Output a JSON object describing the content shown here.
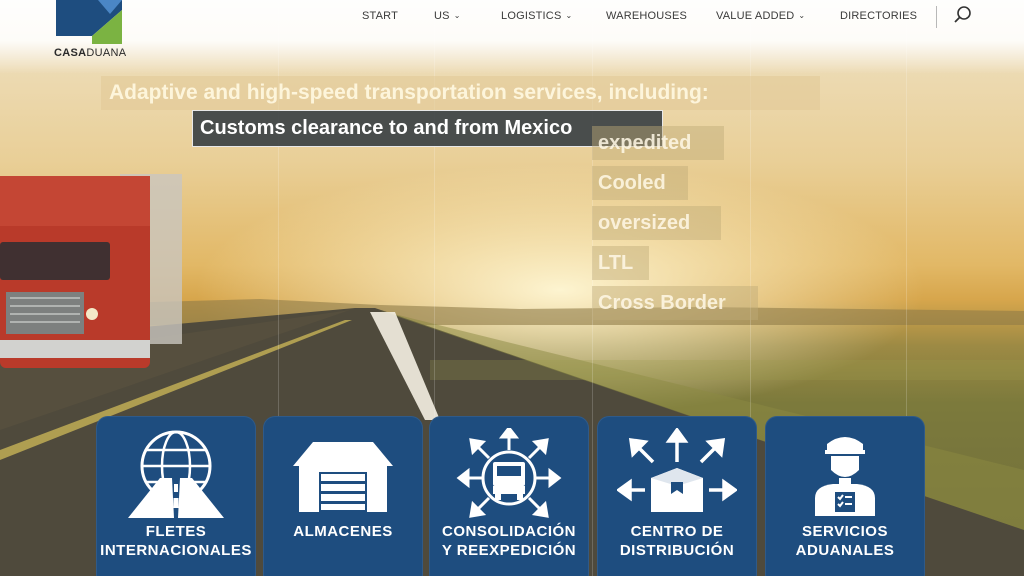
{
  "brand": {
    "logo_text_bold": "CASA",
    "logo_text_light": "DUANA",
    "colors": {
      "blue": "#1e4d7f",
      "green": "#7bb342",
      "light_blue": "#4a86c5"
    }
  },
  "nav": {
    "items": [
      {
        "label": "START",
        "has_dropdown": false
      },
      {
        "label": "US",
        "has_dropdown": true
      },
      {
        "label": "LOGISTICS",
        "has_dropdown": true
      },
      {
        "label": "WAREHOUSES",
        "has_dropdown": false
      },
      {
        "label": "VALUE ADDED",
        "has_dropdown": true
      },
      {
        "label": "DIRECTORIES",
        "has_dropdown": false
      }
    ],
    "search_icon": "search-icon"
  },
  "hero": {
    "headline": "Adaptive and high-speed transportation services, including:",
    "featured": "Customs clearance to and from Mexico",
    "services": [
      "expedited",
      "Cooled",
      "oversized",
      "LTL",
      "Cross Border"
    ]
  },
  "cards": [
    {
      "line1": "FLETES",
      "line2": "INTERNACIONALES",
      "icon": "globe-road-icon"
    },
    {
      "line1": "ALMACENES",
      "line2": "",
      "icon": "warehouse-icon"
    },
    {
      "line1": "CONSOLIDACIÓN",
      "line2": "Y REEXPEDICIÓN",
      "icon": "truck-arrows-icon"
    },
    {
      "line1": "CENTRO DE",
      "line2": "DISTRIBUCIÓN",
      "icon": "box-arrows-icon"
    },
    {
      "line1": "SERVICIOS",
      "line2": "ADUANALES",
      "icon": "customs-officer-icon"
    }
  ]
}
